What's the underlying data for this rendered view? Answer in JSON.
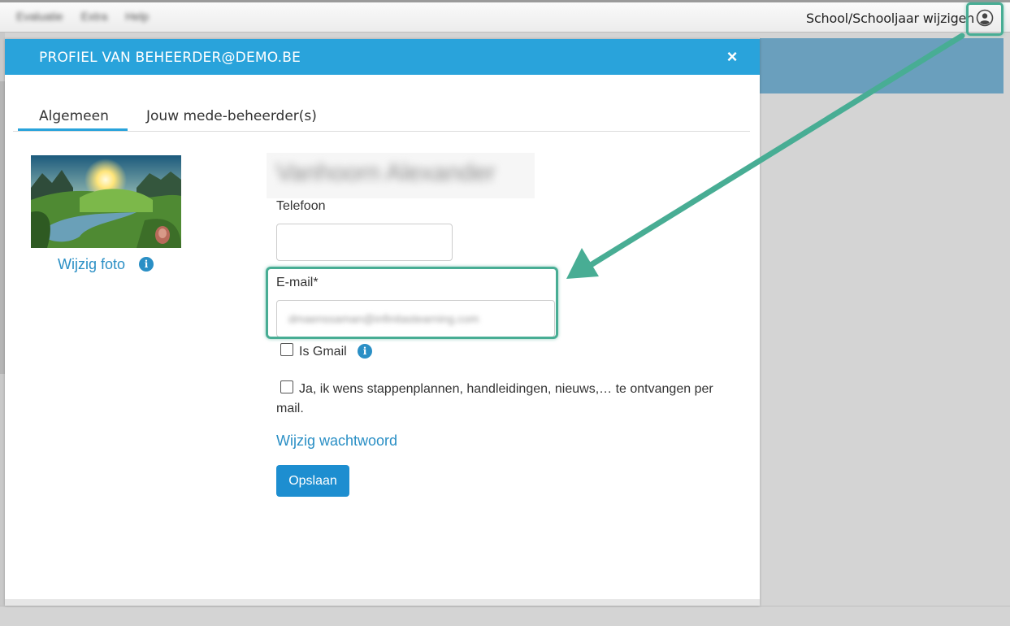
{
  "menubar": {
    "items": [
      "Evaluatie",
      "Extra",
      "Help"
    ],
    "school_link": "School/Schooljaar wijzigen",
    "user_icon": "user-circle-icon"
  },
  "modal": {
    "title": "PROFIEL VAN BEHEERDER@DEMO.BE",
    "close_label": "×",
    "tabs": [
      {
        "label": "Algemeen",
        "active": true
      },
      {
        "label": "Jouw mede-beheerder(s)",
        "active": false
      }
    ],
    "photo_link": "Wijzig foto",
    "info_icon": "i",
    "name_blurred": "Vanhoorn Alexander",
    "phone_label": "Telefoon",
    "phone_value": "",
    "email_label": "E-mail*",
    "email_value_blurred": "dmaenssaman@infinitastearning.com",
    "gmail_label": "Is Gmail",
    "gmail_checked": false,
    "newsletter_label": "Ja, ik wens stappenplannen, handleidingen, nieuws,… te ontvangen per mail.",
    "newsletter_checked": false,
    "password_link": "Wijzig wachtwoord",
    "save_label": "Opslaan"
  },
  "colors": {
    "header_blue": "#29a3db",
    "link_blue": "#2a8fc5",
    "button_blue": "#1d8ed0",
    "highlight_green": "#48ad94"
  }
}
